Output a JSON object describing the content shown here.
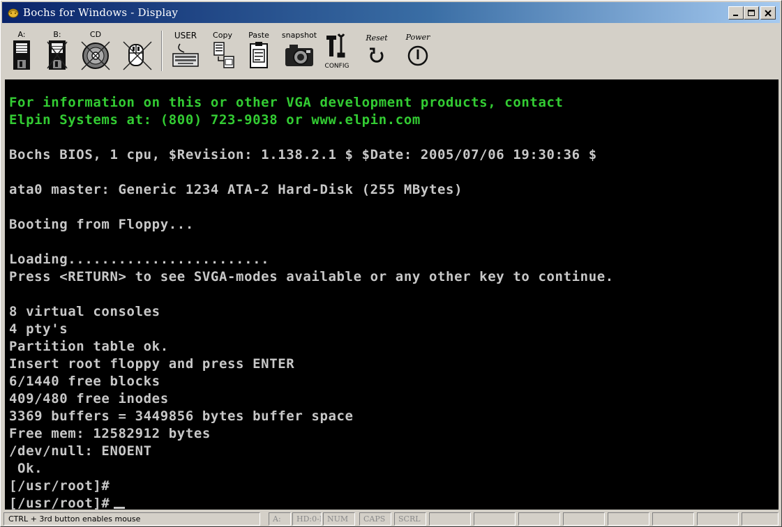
{
  "window": {
    "title": "Bochs for Windows - Display"
  },
  "toolbar": {
    "buttons": [
      {
        "label": "A:",
        "icon": "floppy-a-icon"
      },
      {
        "label": "B:",
        "icon": "floppy-b-icon"
      },
      {
        "label": "CD",
        "icon": "cdrom-icon"
      },
      {
        "label": "",
        "icon": "mouse-icon"
      },
      {
        "label": "USER",
        "icon": "keyboard-icon"
      },
      {
        "label": "Copy",
        "icon": "copy-icon"
      },
      {
        "label": "Paste",
        "icon": "paste-icon"
      },
      {
        "label": "snapshot",
        "icon": "camera-icon"
      },
      {
        "label": "CONFIG",
        "icon": "config-icon"
      },
      {
        "label": "Reset",
        "icon": "reset-icon"
      },
      {
        "label": "Power",
        "icon": "power-icon"
      }
    ]
  },
  "console": {
    "lines": [
      {
        "text": "For information on this or other VGA development products, contact",
        "color": "green"
      },
      {
        "text": "Elpin Systems at: (800) 723-9038 or www.elpin.com",
        "color": "green"
      },
      {
        "text": "Bochs BIOS, 1 cpu, $Revision: 1.138.2.1 $ $Date: 2005/07/06 19:30:36 $"
      },
      {
        "text": "ata0 master: Generic 1234 ATA-2 Hard-Disk (255 MBytes)"
      },
      {
        "text": "Booting from Floppy..."
      },
      {
        "text": "Loading........................"
      },
      {
        "text": "Press <RETURN> to see SVGA-modes available or any other key to continue."
      },
      {
        "text": "8 virtual consoles"
      },
      {
        "text": "4 pty's"
      },
      {
        "text": "Partition table ok."
      },
      {
        "text": "Insert root floppy and press ENTER"
      },
      {
        "text": "6/1440 free blocks"
      },
      {
        "text": "409/480 free inodes"
      },
      {
        "text": "3369 buffers = 3449856 bytes buffer space"
      },
      {
        "text": "Free mem: 12582912 bytes"
      },
      {
        "text": "/dev/null: ENOENT"
      },
      {
        "text": " Ok."
      },
      {
        "text": "[/usr/root]#"
      },
      {
        "text": "[/usr/root]#"
      }
    ]
  },
  "statusbar": {
    "message": "CTRL + 3rd button enables mouse",
    "indicators": [
      "A:",
      "HD:0-M",
      "NUM",
      "CAPS",
      "SCRL"
    ]
  },
  "colors": {
    "console_bg": "#000000",
    "console_text": "#c8c8c8",
    "console_green": "#33cc33",
    "titlebar_start": "#0a246a",
    "chrome": "#d4d0c8"
  }
}
